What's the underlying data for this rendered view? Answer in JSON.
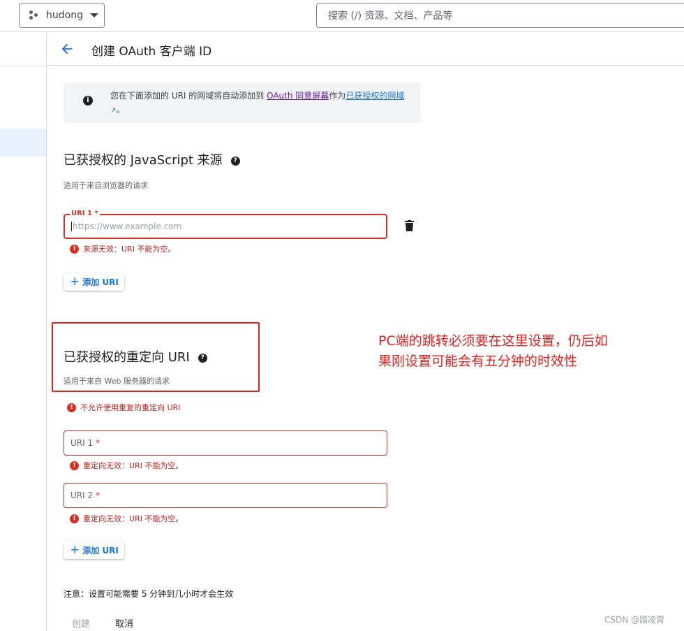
{
  "topbar": {
    "project_name": "hudong",
    "search_placeholder": "搜索 (/) 资源、文档、产品等"
  },
  "header": {
    "title": "创建 OAuth 客户端 ID"
  },
  "info": {
    "text_before": "您在下面添加的 URI 的网域将自动添加到 ",
    "link1": "OAuth 同意屏幕",
    "text_mid": "作为",
    "link2": "已获授权的网域",
    "text_end": "。"
  },
  "js_origins": {
    "title": "已获授权的 JavaScript 来源",
    "subtitle": "适用于来自浏览器的请求",
    "field_label": "URI 1",
    "required_mark": "*",
    "placeholder": "https://www.example.com",
    "error": "来源无效：URI 不能为空。",
    "add_label": "添加 URI"
  },
  "redirect_uris": {
    "title": "已获授权的重定向 URI",
    "subtitle": "适用于来自 Web 服务器的请求",
    "duplicate_error": "不允许使用重复的重定向 URI",
    "fields": [
      {
        "label": "URI 1",
        "error": "重定向无效：URI 不能为空。"
      },
      {
        "label": "URI 2",
        "error": "重定向无效：URI 不能为空。"
      }
    ],
    "required_mark": "*",
    "add_label": "添加 URI"
  },
  "annotation": "PC端的跳转必须要在这里设置，仍后如果刚设置可能会有五分钟的时效性",
  "footer": {
    "note": "注意：设置可能需要 5 分钟到几小时才会生效",
    "create_label": "创建",
    "cancel_label": "取消"
  },
  "watermark": "CSDN @踏凌霄",
  "colors": {
    "accent": "#1a73e8",
    "error": "#d93025",
    "annotation": "#e8201d"
  }
}
